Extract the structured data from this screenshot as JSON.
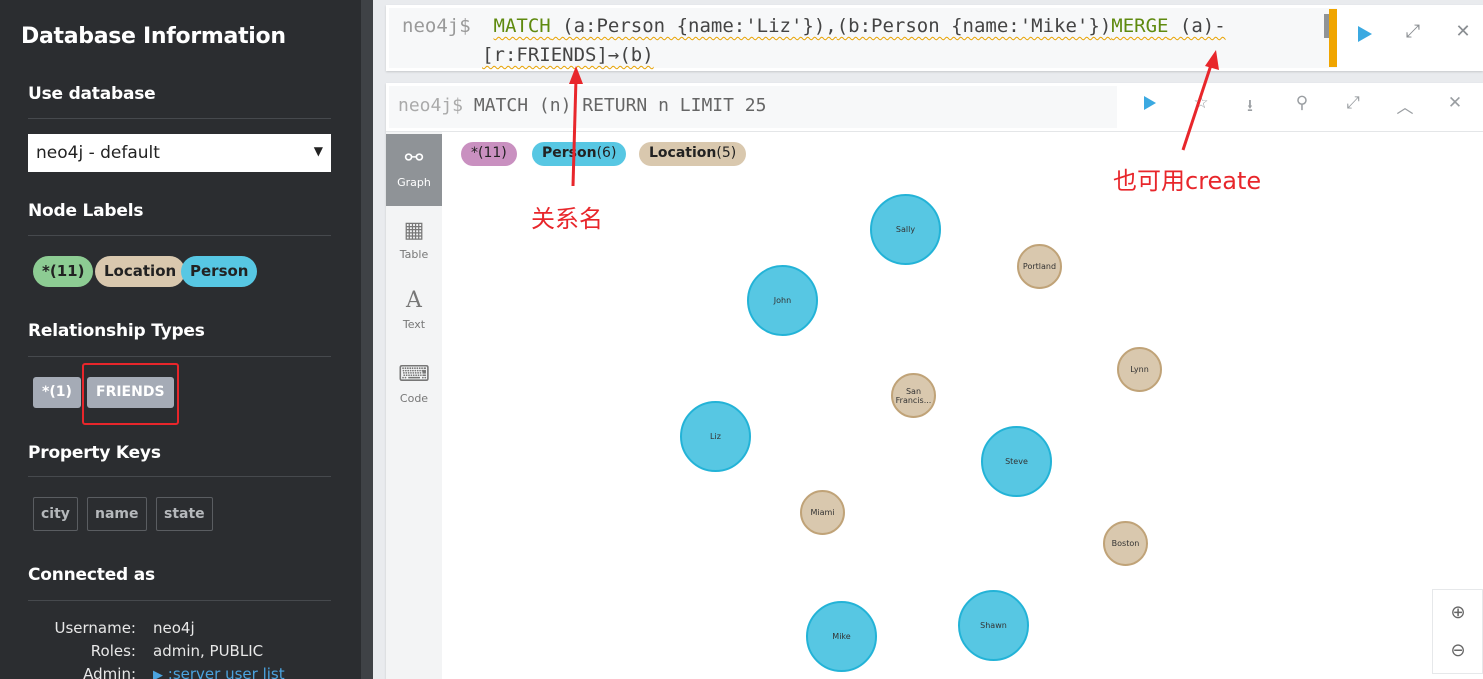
{
  "sidebar": {
    "title": "Database Information",
    "use_database": {
      "heading": "Use database",
      "selected": "neo4j - default"
    },
    "node_labels": {
      "heading": "Node Labels",
      "items": [
        "*(11)",
        "Location",
        "Person"
      ],
      "colors": [
        "#8dcc93",
        "#d9c8ae",
        "#57c7e3"
      ]
    },
    "relationship_types": {
      "heading": "Relationship Types",
      "items": [
        "*(1)",
        "FRIENDS"
      ]
    },
    "property_keys": {
      "heading": "Property Keys",
      "items": [
        "city",
        "name",
        "state"
      ]
    },
    "connected_as": {
      "heading": "Connected as",
      "username_label": "Username:",
      "username": "neo4j",
      "roles_label": "Roles:",
      "roles": "admin, PUBLIC",
      "admin_label": "Admin:",
      "admin": ":server user list"
    }
  },
  "editor": {
    "prompt": "neo4j$",
    "line1_a": "MATCH",
    "line1_b": " (a:Person {name:'Liz'}),",
    "line1_c": "(b:Person {name:'Mike'})",
    "line1_d": "MERGE",
    "line1_e": " (a)-",
    "line2": "[r:FRIENDS]→(b)"
  },
  "frame": {
    "prompt": "neo4j$",
    "query": "MATCH (n) RETURN n LIMIT 25",
    "tabs": [
      "Graph",
      "Table",
      "Text",
      "Code"
    ],
    "pills": [
      {
        "label": "*",
        "count": "(11)",
        "color": "#c990c0"
      },
      {
        "label": "Person",
        "count": "(6)",
        "color": "#57c7e3"
      },
      {
        "label": "Location",
        "count": "(5)",
        "color": "#d9c8ae"
      }
    ],
    "nodes": {
      "sally": "Sally",
      "portland": "Portland",
      "john": "John",
      "lynn": "Lynn",
      "sf": "San Francis...",
      "liz": "Liz",
      "steve": "Steve",
      "miami": "Miami",
      "boston": "Boston",
      "mike": "Mike",
      "shawn": "Shawn"
    }
  },
  "annotations": {
    "relation_name": "关系名",
    "create_note": "也可用create"
  }
}
